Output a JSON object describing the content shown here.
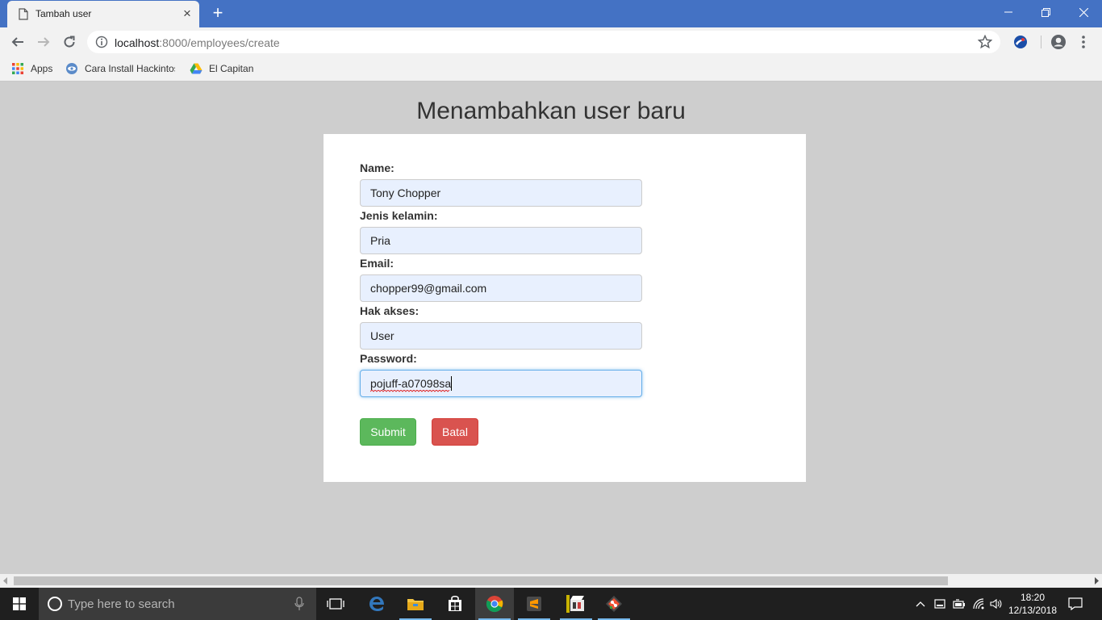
{
  "browser": {
    "tab_title": "Tambah user",
    "new_tab_symbol": "+",
    "url_host": "localhost",
    "url_rest": ":8000/employees/create"
  },
  "bookmarks": [
    {
      "label": "Apps",
      "icon": "apps-grid-icon"
    },
    {
      "label": "Cara Install Hackintos",
      "icon": "hackintosh-site-icon"
    },
    {
      "label": "El Capitan",
      "icon": "google-drive-icon"
    }
  ],
  "page": {
    "title": "Menambahkan user baru"
  },
  "form": {
    "name_label": "Name:",
    "name_value": "Tony Chopper",
    "gender_label": "Jenis kelamin:",
    "gender_value": "Pria",
    "email_label": "Email:",
    "email_value": "chopper99@gmail.com",
    "access_label": "Hak akses:",
    "access_value": "User",
    "password_label": "Password:",
    "password_value": "pojuff-a07098sa",
    "submit_label": "Submit",
    "cancel_label": "Batal"
  },
  "colors": {
    "chrome_titlebar": "#4472c4",
    "submit": "#5cb85c",
    "cancel": "#d9534f",
    "field_bg": "#e8f0fe",
    "page_bg": "#cecece"
  },
  "taskbar": {
    "search_placeholder": "Type here to search",
    "time": "18:20",
    "date": "12/13/2018",
    "apps": [
      "task-view-icon",
      "edge-icon",
      "file-explorer-icon",
      "store-icon",
      "chrome-icon",
      "sublime-text-icon",
      "video-editor-icon",
      "git-icon"
    ]
  }
}
